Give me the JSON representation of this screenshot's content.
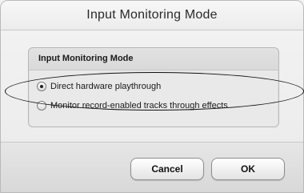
{
  "dialog": {
    "title": "Input Monitoring Mode"
  },
  "panel": {
    "title": "Input Monitoring Mode",
    "options": [
      {
        "label": "Direct hardware playthrough",
        "checked": true
      },
      {
        "label": "Monitor record-enabled tracks through effects",
        "checked": false
      }
    ]
  },
  "buttons": {
    "cancel": "Cancel",
    "ok": "OK"
  }
}
